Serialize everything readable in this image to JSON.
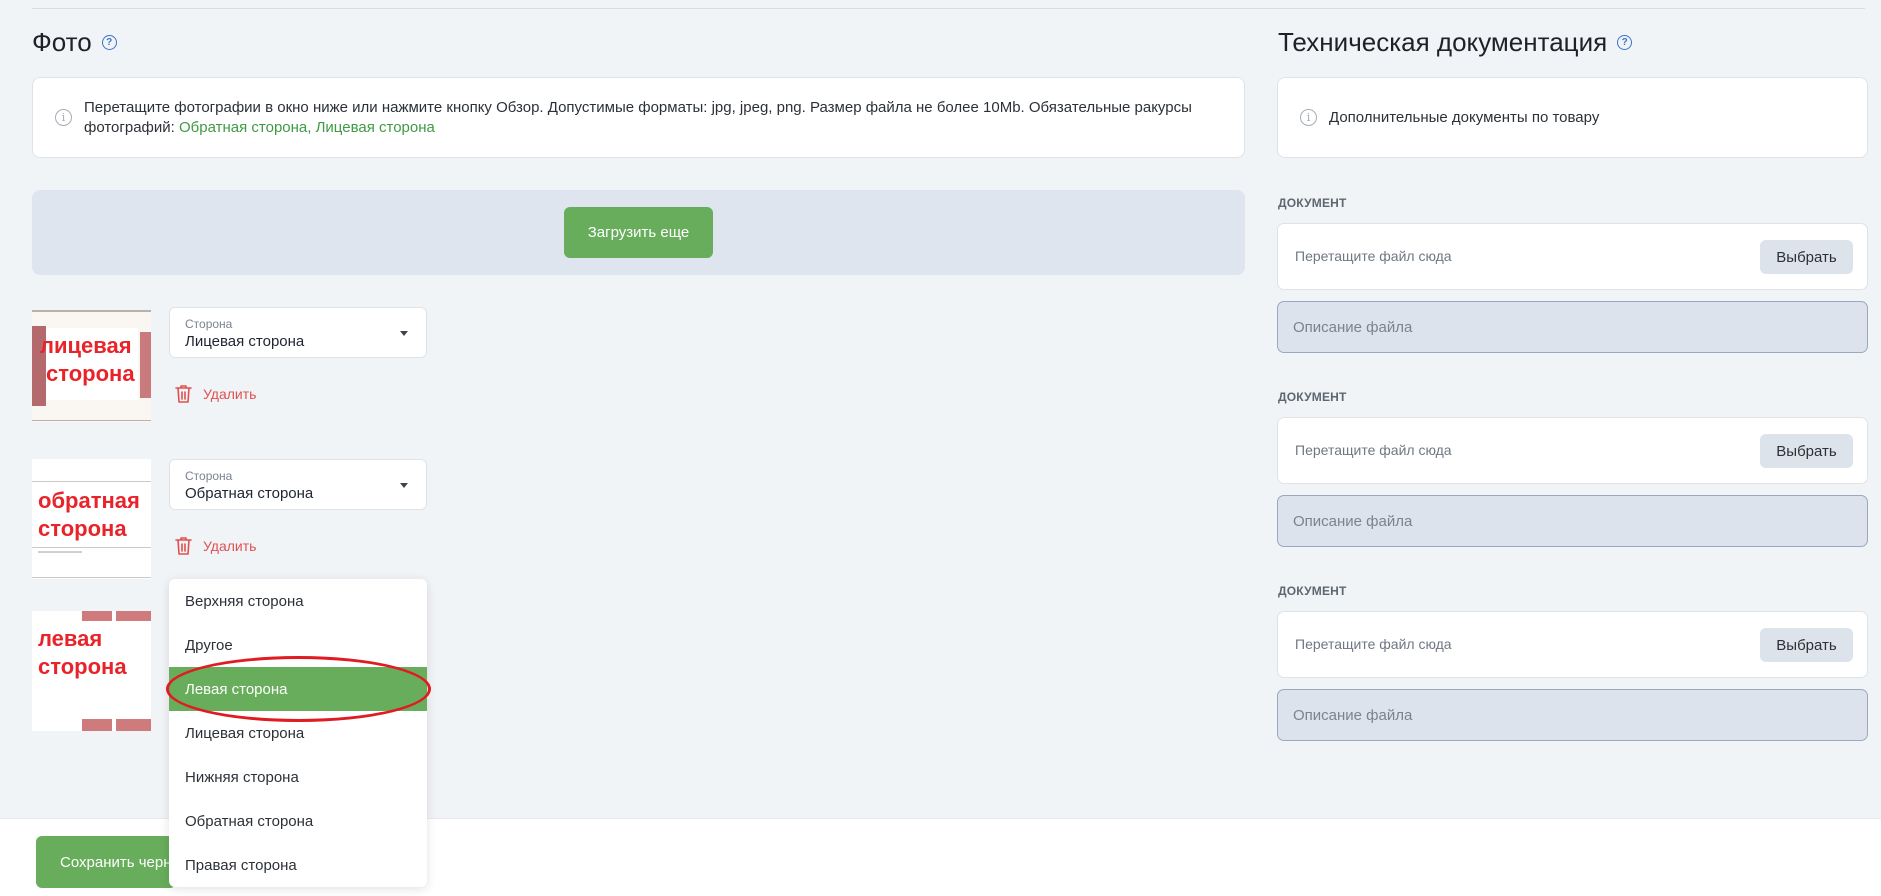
{
  "photo": {
    "title": "Фото",
    "help_icon": "?",
    "info_text": "Перетащите фотографии в окно ниже или нажмите кнопку Обзор. Допустимые форматы: jpg, jpeg, png. Размер файла не более 10Mb. Обязательные ракурсы фотографий:",
    "info_required": "Обратная сторона, Лицевая сторона",
    "upload_more": "Загрузить еще",
    "items": [
      {
        "thumb_line1": "лицевая",
        "thumb_line2": "сторона",
        "select_label": "Сторона",
        "select_value": "Лицевая сторона",
        "delete_label": "Удалить"
      },
      {
        "thumb_line1": "обратная",
        "thumb_line2": "сторона",
        "select_label": "Сторона",
        "select_value": "Обратная сторона",
        "delete_label": "Удалить"
      },
      {
        "thumb_line1": "левая",
        "thumb_line2": "сторона"
      }
    ],
    "dropdown_options": [
      "Верхняя сторона",
      "Другое",
      "Левая сторона",
      "Лицевая сторона",
      "Нижняя сторона",
      "Обратная сторона",
      "Правая сторона"
    ],
    "selected_option": "Левая сторона"
  },
  "tech_docs": {
    "title": "Техническая документация",
    "info_text": "Дополнительные документы по товару",
    "documents": [
      {
        "label": "ДОКУМЕНТ",
        "drop_placeholder": "Перетащите файл сюда",
        "choose_label": "Выбрать",
        "description_placeholder": "Описание файла"
      },
      {
        "label": "ДОКУМЕНТ",
        "drop_placeholder": "Перетащите файл сюда",
        "choose_label": "Выбрать",
        "description_placeholder": "Описание файла"
      },
      {
        "label": "ДОКУМЕНТ",
        "drop_placeholder": "Перетащите файл сюда",
        "choose_label": "Выбрать",
        "description_placeholder": "Описание файла"
      }
    ]
  },
  "footer": {
    "save_draft_label": "Сохранить черн"
  },
  "colors": {
    "accent_green": "#67ad5b",
    "danger_red": "#e15050",
    "annotation_red": "#e01c22"
  },
  "icons": [
    "help-icon",
    "info-icon",
    "trash-icon",
    "chevron-down-icon"
  ]
}
